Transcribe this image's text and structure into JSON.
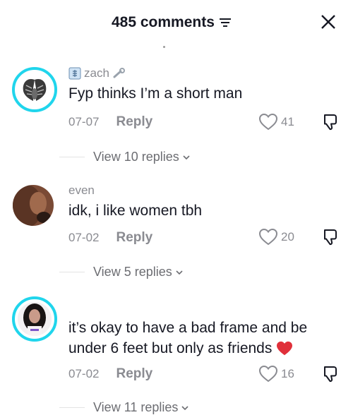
{
  "header": {
    "title": "485 comments"
  },
  "comments": [
    {
      "username": "zach",
      "text": "Fyp thinks I’m a short man",
      "date": "07-07",
      "reply_label": "Reply",
      "likes": "41",
      "view_replies": "View 10 replies"
    },
    {
      "username": "even",
      "text": "idk, i like women tbh",
      "date": "07-02",
      "reply_label": "Reply",
      "likes": "20",
      "view_replies": "View 5 replies"
    },
    {
      "username": "",
      "text_line1": "it’s okay to have a bad frame and be",
      "text_line2": "under 6 feet but only as friends",
      "date": "07-02",
      "reply_label": "Reply",
      "likes": "16",
      "view_replies": "View 11 replies"
    }
  ],
  "colors": {
    "ring": "#20d5ec",
    "heart_emoji": "#e0303a",
    "muted": "#8a8b91"
  }
}
